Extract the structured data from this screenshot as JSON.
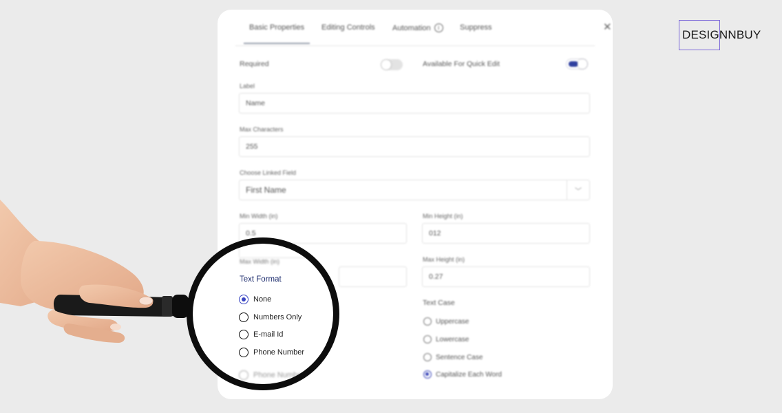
{
  "brand": {
    "text": "DESIGNNBUY",
    "accent": "#7b68d9"
  },
  "dialog": {
    "tabs": [
      {
        "label": "Basic Properties",
        "active": true
      },
      {
        "label": "Editing Controls",
        "active": false
      },
      {
        "label": "Automation",
        "active": false,
        "icon": "info-icon"
      },
      {
        "label": "Suppress",
        "active": false
      }
    ],
    "close_icon": "close-icon",
    "required": {
      "label": "Required",
      "on": false
    },
    "quick_edit": {
      "label": "Available For Quick Edit",
      "on": true
    },
    "label_field": {
      "label": "Label",
      "value": "Name"
    },
    "max_chars": {
      "label": "Max Characters",
      "value": "255"
    },
    "linked_field": {
      "label": "Choose Linked Field",
      "value": "First Name"
    },
    "min_width": {
      "label": "Min Width (in)",
      "value": "0.5"
    },
    "min_height": {
      "label": "Min Height (in)",
      "value": "012"
    },
    "max_width": {
      "label": "Max Width (in)",
      "value": ""
    },
    "max_height": {
      "label": "Max Height (in)",
      "value": "0.27"
    },
    "text_format": {
      "label": "Text Format",
      "options": [
        "None",
        "Numbers Only",
        "E-mail Id",
        "Phone Number",
        "Phone Number"
      ],
      "selected": "None"
    },
    "text_case": {
      "label": "Text Case",
      "options": [
        "Uppercase",
        "Lowercase",
        "Sentence Case",
        "Capitalize Each Word"
      ],
      "selected": "Capitalize Each Word"
    }
  },
  "colors": {
    "accent": "#3a46c2",
    "toggle_on": "#2e3f9f",
    "heading": "#1e2d6e"
  }
}
